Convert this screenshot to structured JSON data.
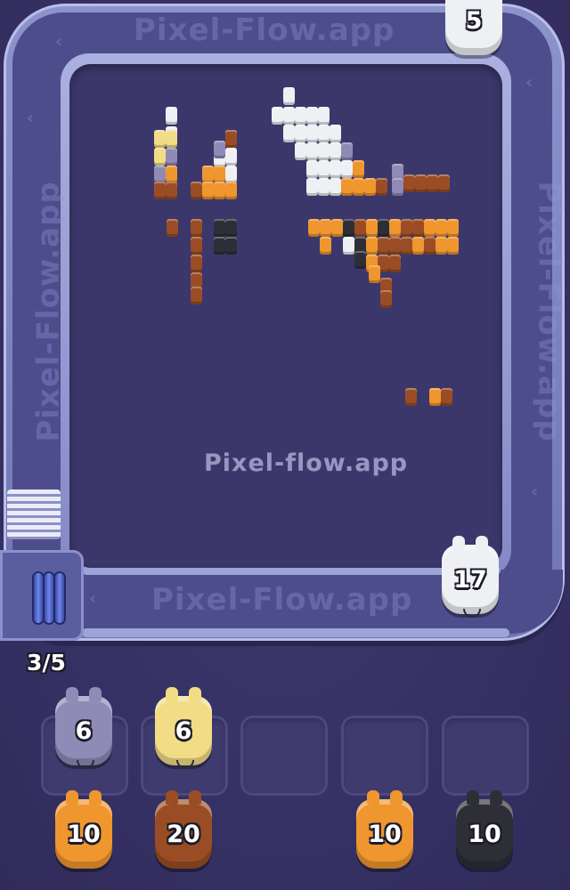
{
  "watermark": {
    "center": "Pixel-flow.app",
    "top": "Pixel-Flow.app",
    "bottom": "Pixel-Flow.app",
    "left": "Pixel-Flow.app",
    "right": "Pixel-Flow.app"
  },
  "queue_counter": "3/5",
  "belt_pigs": [
    {
      "name": "belt-pig-top",
      "count": "5",
      "color": "#eef0f4"
    },
    {
      "name": "belt-pig-right",
      "count": "17",
      "color": "#eef0f4"
    }
  ],
  "holding_slots": [
    {
      "pig": {
        "count": "6",
        "color": "#8f8ab6"
      }
    },
    {
      "pig": {
        "count": "6",
        "color": "#f2dc86"
      }
    },
    {
      "pig": null
    },
    {
      "pig": null
    },
    {
      "pig": null
    }
  ],
  "queue_pigs": [
    {
      "count": "10",
      "color": "#ef962e"
    },
    {
      "count": "20",
      "color": "#9a4d24"
    },
    {
      "count": "10",
      "color": "#ef962e"
    },
    {
      "count": "10",
      "color": "#2e2e36"
    }
  ],
  "colors": {
    "background": "#3a3568",
    "track": "#8d93cc",
    "board": "#3b376b"
  }
}
